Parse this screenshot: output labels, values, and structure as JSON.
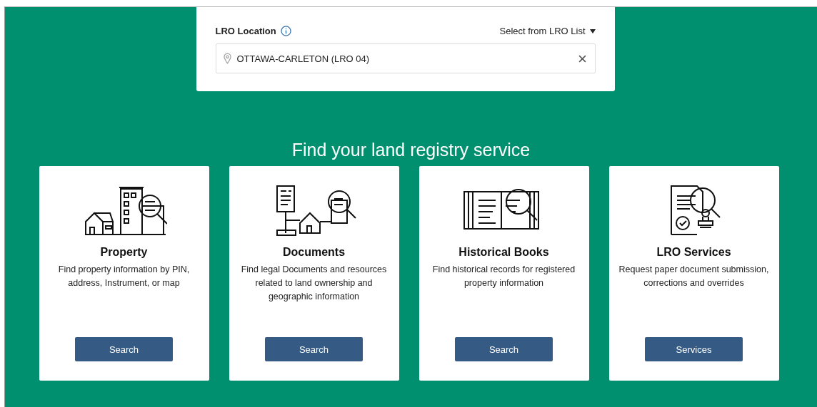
{
  "location": {
    "label": "LRO Location",
    "list_link": "Select from LRO List",
    "value": "OTTAWA-CARLETON (LRO 04)"
  },
  "heading": "Find your land registry service",
  "cards": [
    {
      "kind": "property",
      "title": "Property",
      "description": "Find property information by PIN, address, Instrument, or map",
      "button": "Search"
    },
    {
      "kind": "documents",
      "title": "Documents",
      "description": "Find legal Documents and resources related to land ownership and geographic information",
      "button": "Search"
    },
    {
      "kind": "books",
      "title": "Historical Books",
      "description": "Find historical records for registered property information",
      "button": "Search"
    },
    {
      "kind": "services",
      "title": "LRO Services",
      "description": "Request paper document submission, corrections and overrides",
      "button": "Services"
    }
  ]
}
